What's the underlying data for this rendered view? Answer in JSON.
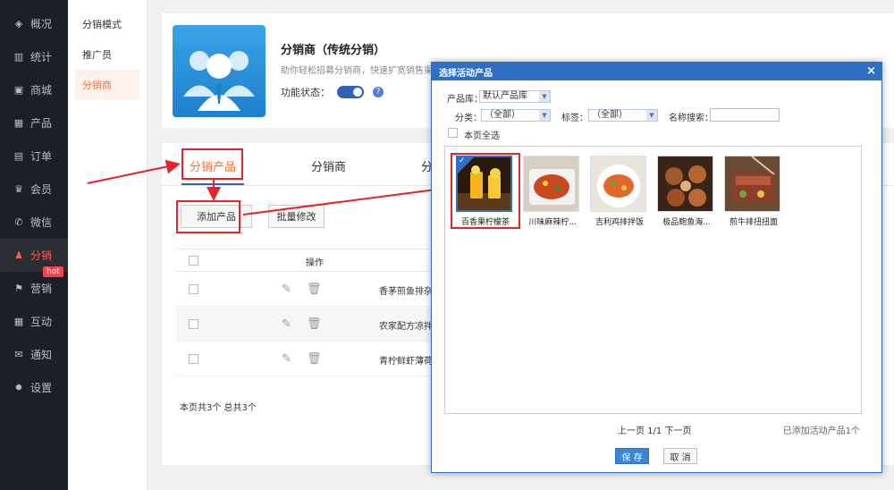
{
  "sidebar": {
    "items": [
      {
        "label": "概况",
        "icon": "layers-icon",
        "glyph": "◈"
      },
      {
        "label": "统计",
        "icon": "chart-icon",
        "glyph": "▥"
      },
      {
        "label": "商城",
        "icon": "store-icon",
        "glyph": "▣"
      },
      {
        "label": "产品",
        "icon": "product-icon",
        "glyph": "▦"
      },
      {
        "label": "订单",
        "icon": "order-icon",
        "glyph": "▤"
      },
      {
        "label": "会员",
        "icon": "crown-icon",
        "glyph": "♛"
      },
      {
        "label": "微信",
        "icon": "wechat-icon",
        "glyph": "✆"
      },
      {
        "label": "分销",
        "icon": "distribution-icon",
        "glyph": "♟"
      },
      {
        "label": "营销",
        "icon": "flag-icon",
        "glyph": "⚑"
      },
      {
        "label": "互动",
        "icon": "interact-icon",
        "glyph": "▦"
      },
      {
        "label": "通知",
        "icon": "mail-icon",
        "glyph": "✉"
      },
      {
        "label": "设置",
        "icon": "gear-icon",
        "glyph": "✹"
      }
    ],
    "hot_badge": "hot"
  },
  "subnav": {
    "items": [
      "分销模式",
      "推广员",
      "分销商"
    ]
  },
  "header": {
    "title": "分销商（传统分销）",
    "desc": "助你轻松招募分销商，快速扩宽销售渠道",
    "state_label": "功能状态：",
    "help": "?"
  },
  "panel": {
    "tabs": [
      "分销产品",
      "分销商",
      "分"
    ],
    "add_button": "添加产品",
    "batch_button": "批量修改",
    "op_header": "操作",
    "rows": [
      "香茅煎鱼排杂",
      "农家配方凉拌",
      "青柠鲜虾薄荷"
    ],
    "footer": "本页共3个  总共3个"
  },
  "modal": {
    "title": "选择活动产品",
    "close": "×",
    "library_label": "产品库：",
    "library_value": "默认产品库",
    "category_label": "分类：",
    "category_value": "（全部）",
    "tag_label": "标签：",
    "tag_value": "（全部）",
    "search_label": "名称搜索：",
    "select_all_label": "本页全选",
    "products": [
      {
        "name": "百香果柠檬茶",
        "selected": true
      },
      {
        "name": "川味麻辣柠...",
        "selected": false
      },
      {
        "name": "吉利鸡排拌饭",
        "selected": false
      },
      {
        "name": "极品鲍鱼海...",
        "selected": false
      },
      {
        "name": "煎牛排扭扭面",
        "selected": false
      }
    ],
    "pager": "上一页 1/1 下一页",
    "added_text": "已添加活动产品1个",
    "save_label": "保 存",
    "cancel_label": "取 消"
  },
  "colors": {
    "accent_blue": "#2f70c3",
    "accent_orange": "#ff6d3b",
    "highlight_red": "#e3242b",
    "sidebar_bg": "#1d1f26"
  }
}
